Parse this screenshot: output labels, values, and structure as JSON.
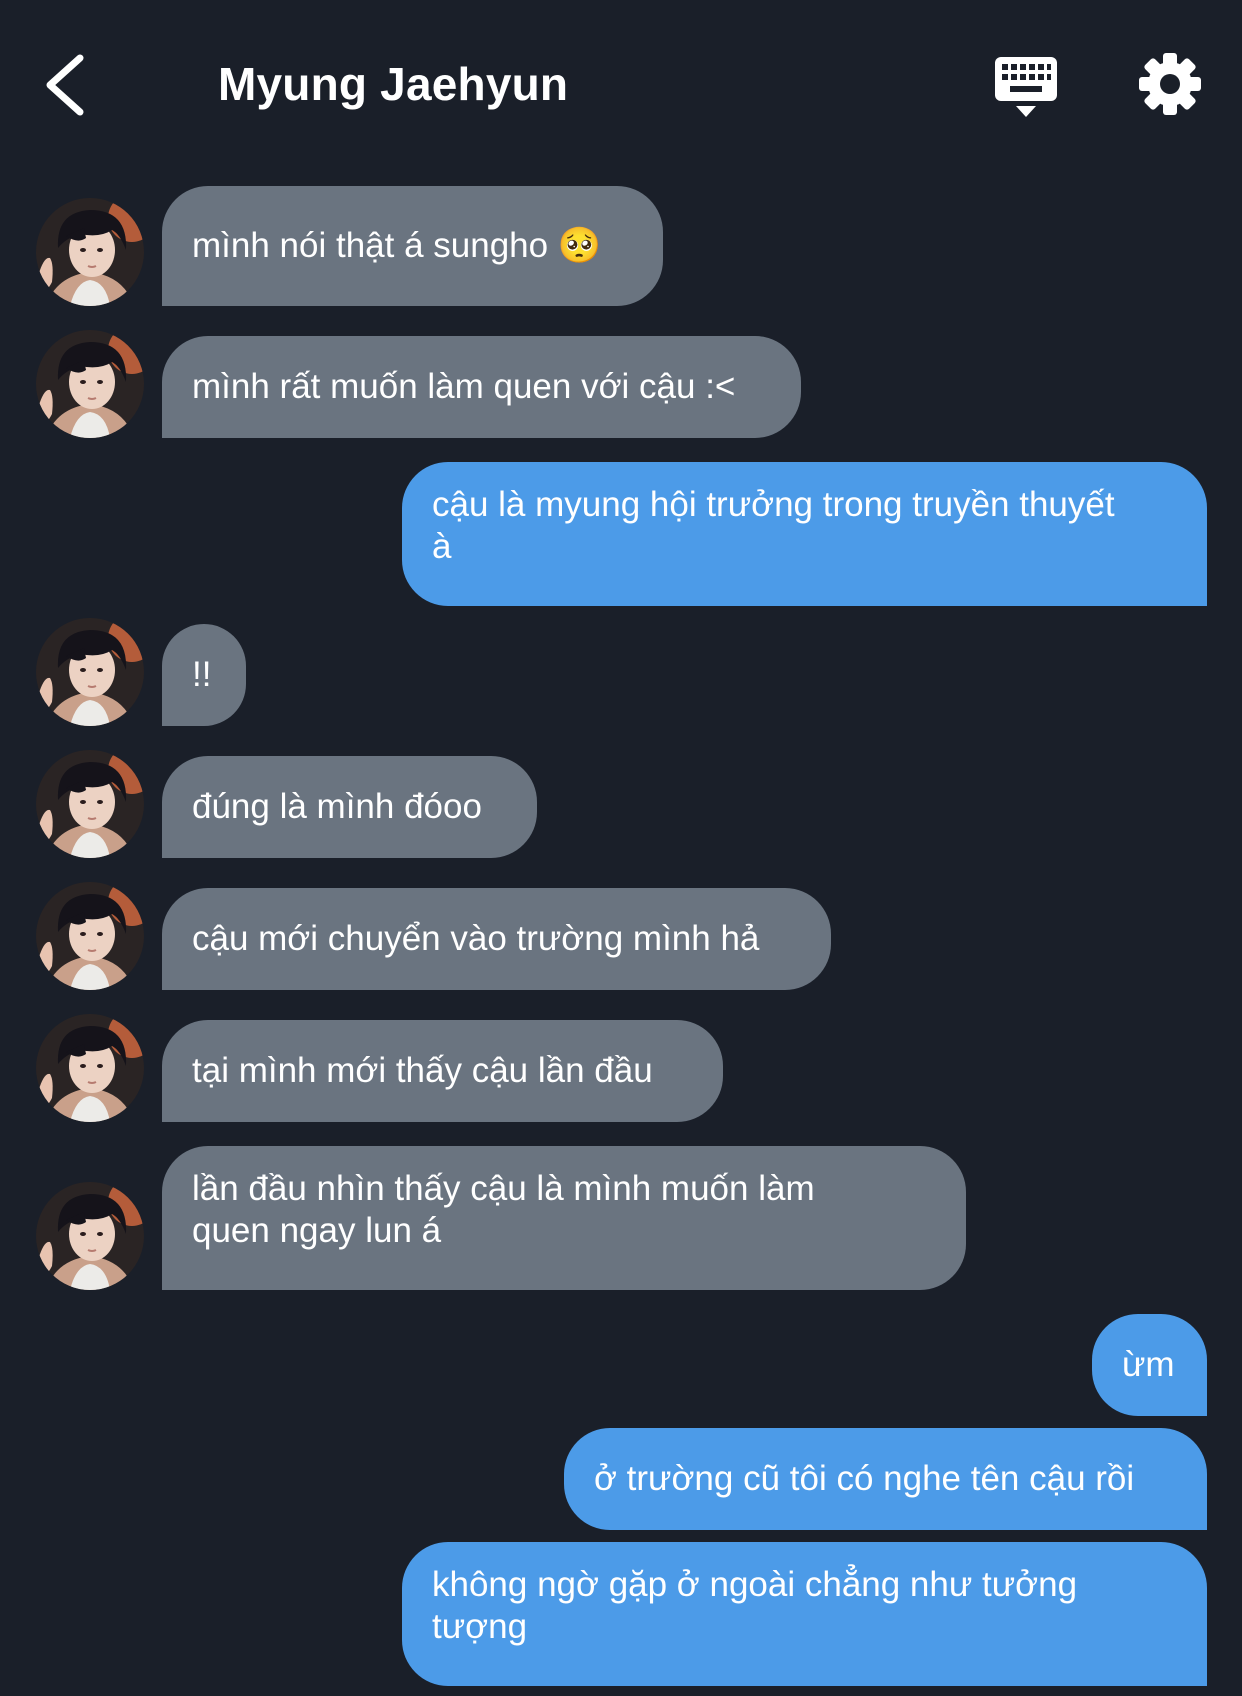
{
  "header": {
    "back_icon": "chevron-left-icon",
    "title": "Myung Jaehyun",
    "keyboard_icon": "keyboard-hide-icon",
    "settings_icon": "gear-icon"
  },
  "colors": {
    "background": "#1a1f29",
    "incoming_bubble": "#6a7480",
    "outgoing_bubble": "#4c9be8",
    "text": "#ffffff"
  },
  "messages": [
    {
      "sender": "other",
      "text": "mình nói thật á sungho 🥺"
    },
    {
      "sender": "other",
      "text": "mình rất muốn làm quen với cậu :<"
    },
    {
      "sender": "me",
      "lines": [
        "cậu là myung hội trưởng trong truyền thuyết",
        "à"
      ]
    },
    {
      "sender": "other",
      "text": "!!"
    },
    {
      "sender": "other",
      "text": "đúng là mình đóoo"
    },
    {
      "sender": "other",
      "text": "cậu mới chuyển vào trường mình hả"
    },
    {
      "sender": "other",
      "text": "tại mình mới thấy cậu lần đầu"
    },
    {
      "sender": "other",
      "lines": [
        "lần đầu nhìn thấy cậu là mình muốn làm",
        "quen ngay lun á"
      ]
    },
    {
      "sender": "me",
      "text": "ừm"
    },
    {
      "sender": "me",
      "text": "ở trường cũ tôi có nghe tên cậu rồi"
    },
    {
      "sender": "me",
      "lines": [
        "không ngờ gặp ở ngoài chẳng như tưởng",
        "tượng"
      ]
    }
  ]
}
